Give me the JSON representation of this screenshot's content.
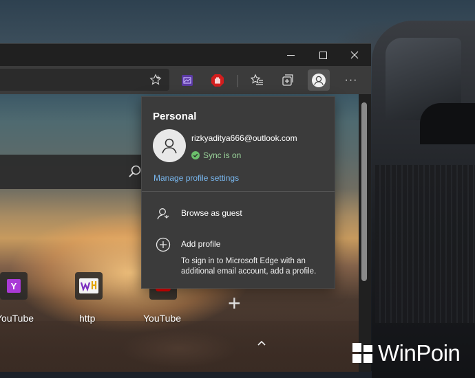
{
  "browser": {
    "window_controls": {
      "minimize": "minimize",
      "maximize": "maximize",
      "close": "close"
    },
    "toolbar": {
      "favorite_icon": "star-outline-icon",
      "extensions": [
        "purple-extension-icon",
        "red-hand-extension-icon"
      ],
      "favorites_icon": "favorites-list-icon",
      "collections_icon": "collections-icon",
      "profile_icon": "person-icon",
      "more_label": "···"
    }
  },
  "profile_flyout": {
    "title": "Personal",
    "email": "rizkyaditya666@outlook.com",
    "sync_status": "Sync is on",
    "manage_link": "Manage profile settings",
    "browse_guest": "Browse as guest",
    "add_profile": "Add profile",
    "add_profile_description": "To sign in to Microsoft Edge with an additional email account, add a profile."
  },
  "new_tab": {
    "tiles": [
      {
        "label": "YouTube",
        "icon": "yahoo-icon",
        "letter": "Y"
      },
      {
        "label": "http",
        "icon": "wikihow-icon",
        "letter": "wH"
      },
      {
        "label": "YouTube",
        "icon": "youtube-icon",
        "letter": ""
      }
    ],
    "add_tile_label": "+"
  },
  "watermark": {
    "text": "WinPoin"
  },
  "colors": {
    "accent_link": "#79b8f0",
    "sync_green": "#6bbf6b",
    "flyout_bg": "#3b3b3b",
    "yahoo_purple": "#a93ad6",
    "youtube_red": "#ff0000"
  }
}
